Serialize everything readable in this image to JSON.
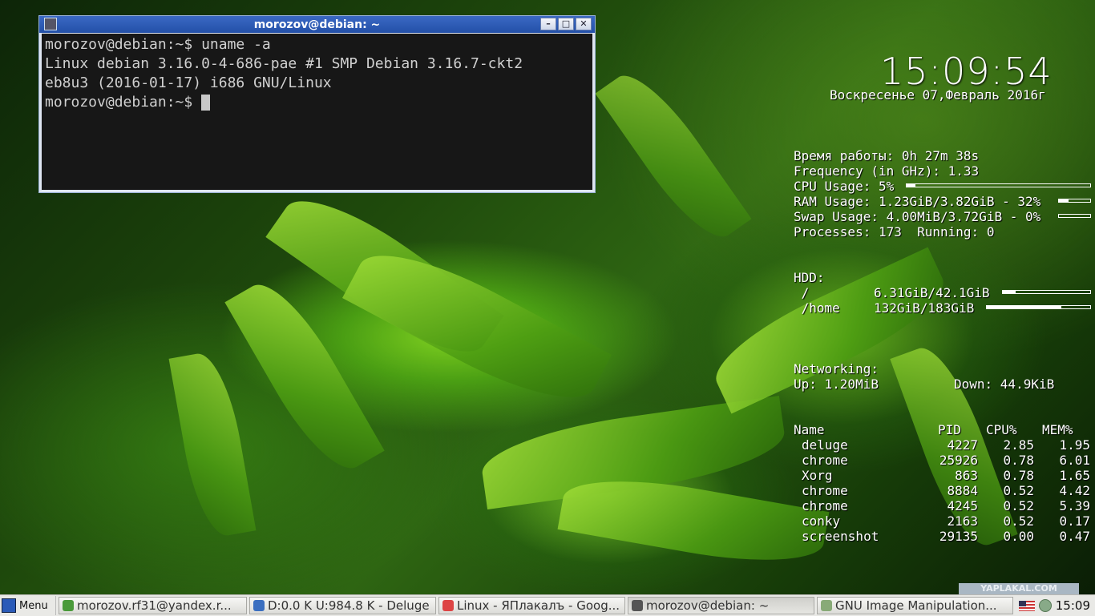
{
  "terminal": {
    "title": "morozov@debian: ~",
    "lines": [
      "morozov@debian:~$ uname -a",
      "Linux debian 3.16.0-4-686-pae #1 SMP Debian 3.16.7-ckt2",
      "eb8u3 (2016-01-17) i686 GNU/Linux",
      "morozov@debian:~$ "
    ],
    "btn_min": "–",
    "btn_max": "□",
    "btn_close": "✕"
  },
  "conky": {
    "time": "15:09:54",
    "date": "Воскресенье 07,Февраль 2016г",
    "uptime": "Время работы: 0h 27m 38s",
    "frequency": "Frequency (in GHz): 1.33",
    "cpu": "CPU Usage: 5%",
    "cpu_pct": 0.05,
    "ram": "RAM Usage: 1.23GiB/3.82GiB - 32%",
    "ram_pct": 0.32,
    "swap": "Swap Usage: 4.00MiB/3.72GiB - 0%",
    "swap_pct": 0.0,
    "processes": "Processes: 173  Running: 0",
    "hdd_label": "HDD:",
    "root_label": " /",
    "root_value": "6.31GiB/42.1GiB",
    "root_pct": 0.15,
    "home_label": " /home",
    "home_value": "132GiB/183GiB",
    "home_pct": 0.72,
    "net_label": "Networking:",
    "up": "Up: 1.20MiB",
    "down": "Down: 44.9KiB",
    "proc_headers": [
      "Name",
      "PID",
      "CPU%",
      "MEM%"
    ],
    "proc_rows": [
      [
        "deluge",
        "4227",
        "2.85",
        "1.95"
      ],
      [
        "chrome",
        "25926",
        "0.78",
        "6.01"
      ],
      [
        "Xorg",
        "863",
        "0.78",
        "1.65"
      ],
      [
        "chrome",
        "8884",
        "0.52",
        "4.42"
      ],
      [
        "chrome",
        "4245",
        "0.52",
        "5.39"
      ],
      [
        "conky",
        "2163",
        "0.52",
        "0.17"
      ],
      [
        "screenshot",
        "29135",
        "0.00",
        "0.47"
      ]
    ]
  },
  "taskbar": {
    "menu_label": "Menu",
    "tasks": [
      {
        "label": "morozov.rf31@yandex.r...",
        "icon_color": "#4a9a3a",
        "active": false
      },
      {
        "label": "D:0.0 K U:984.8 K - Deluge",
        "icon_color": "#3b6fc0",
        "active": false
      },
      {
        "label": "Linux - ЯПлакалъ - Goog...",
        "icon_color": "#d44",
        "active": false
      },
      {
        "label": "morozov@debian: ~",
        "icon_color": "#555",
        "active": true
      },
      {
        "label": "GNU Image Manipulation...",
        "icon_color": "#8a7",
        "active": false
      }
    ],
    "clock": "15:09"
  },
  "watermark": "YAPLAKAL.COM"
}
